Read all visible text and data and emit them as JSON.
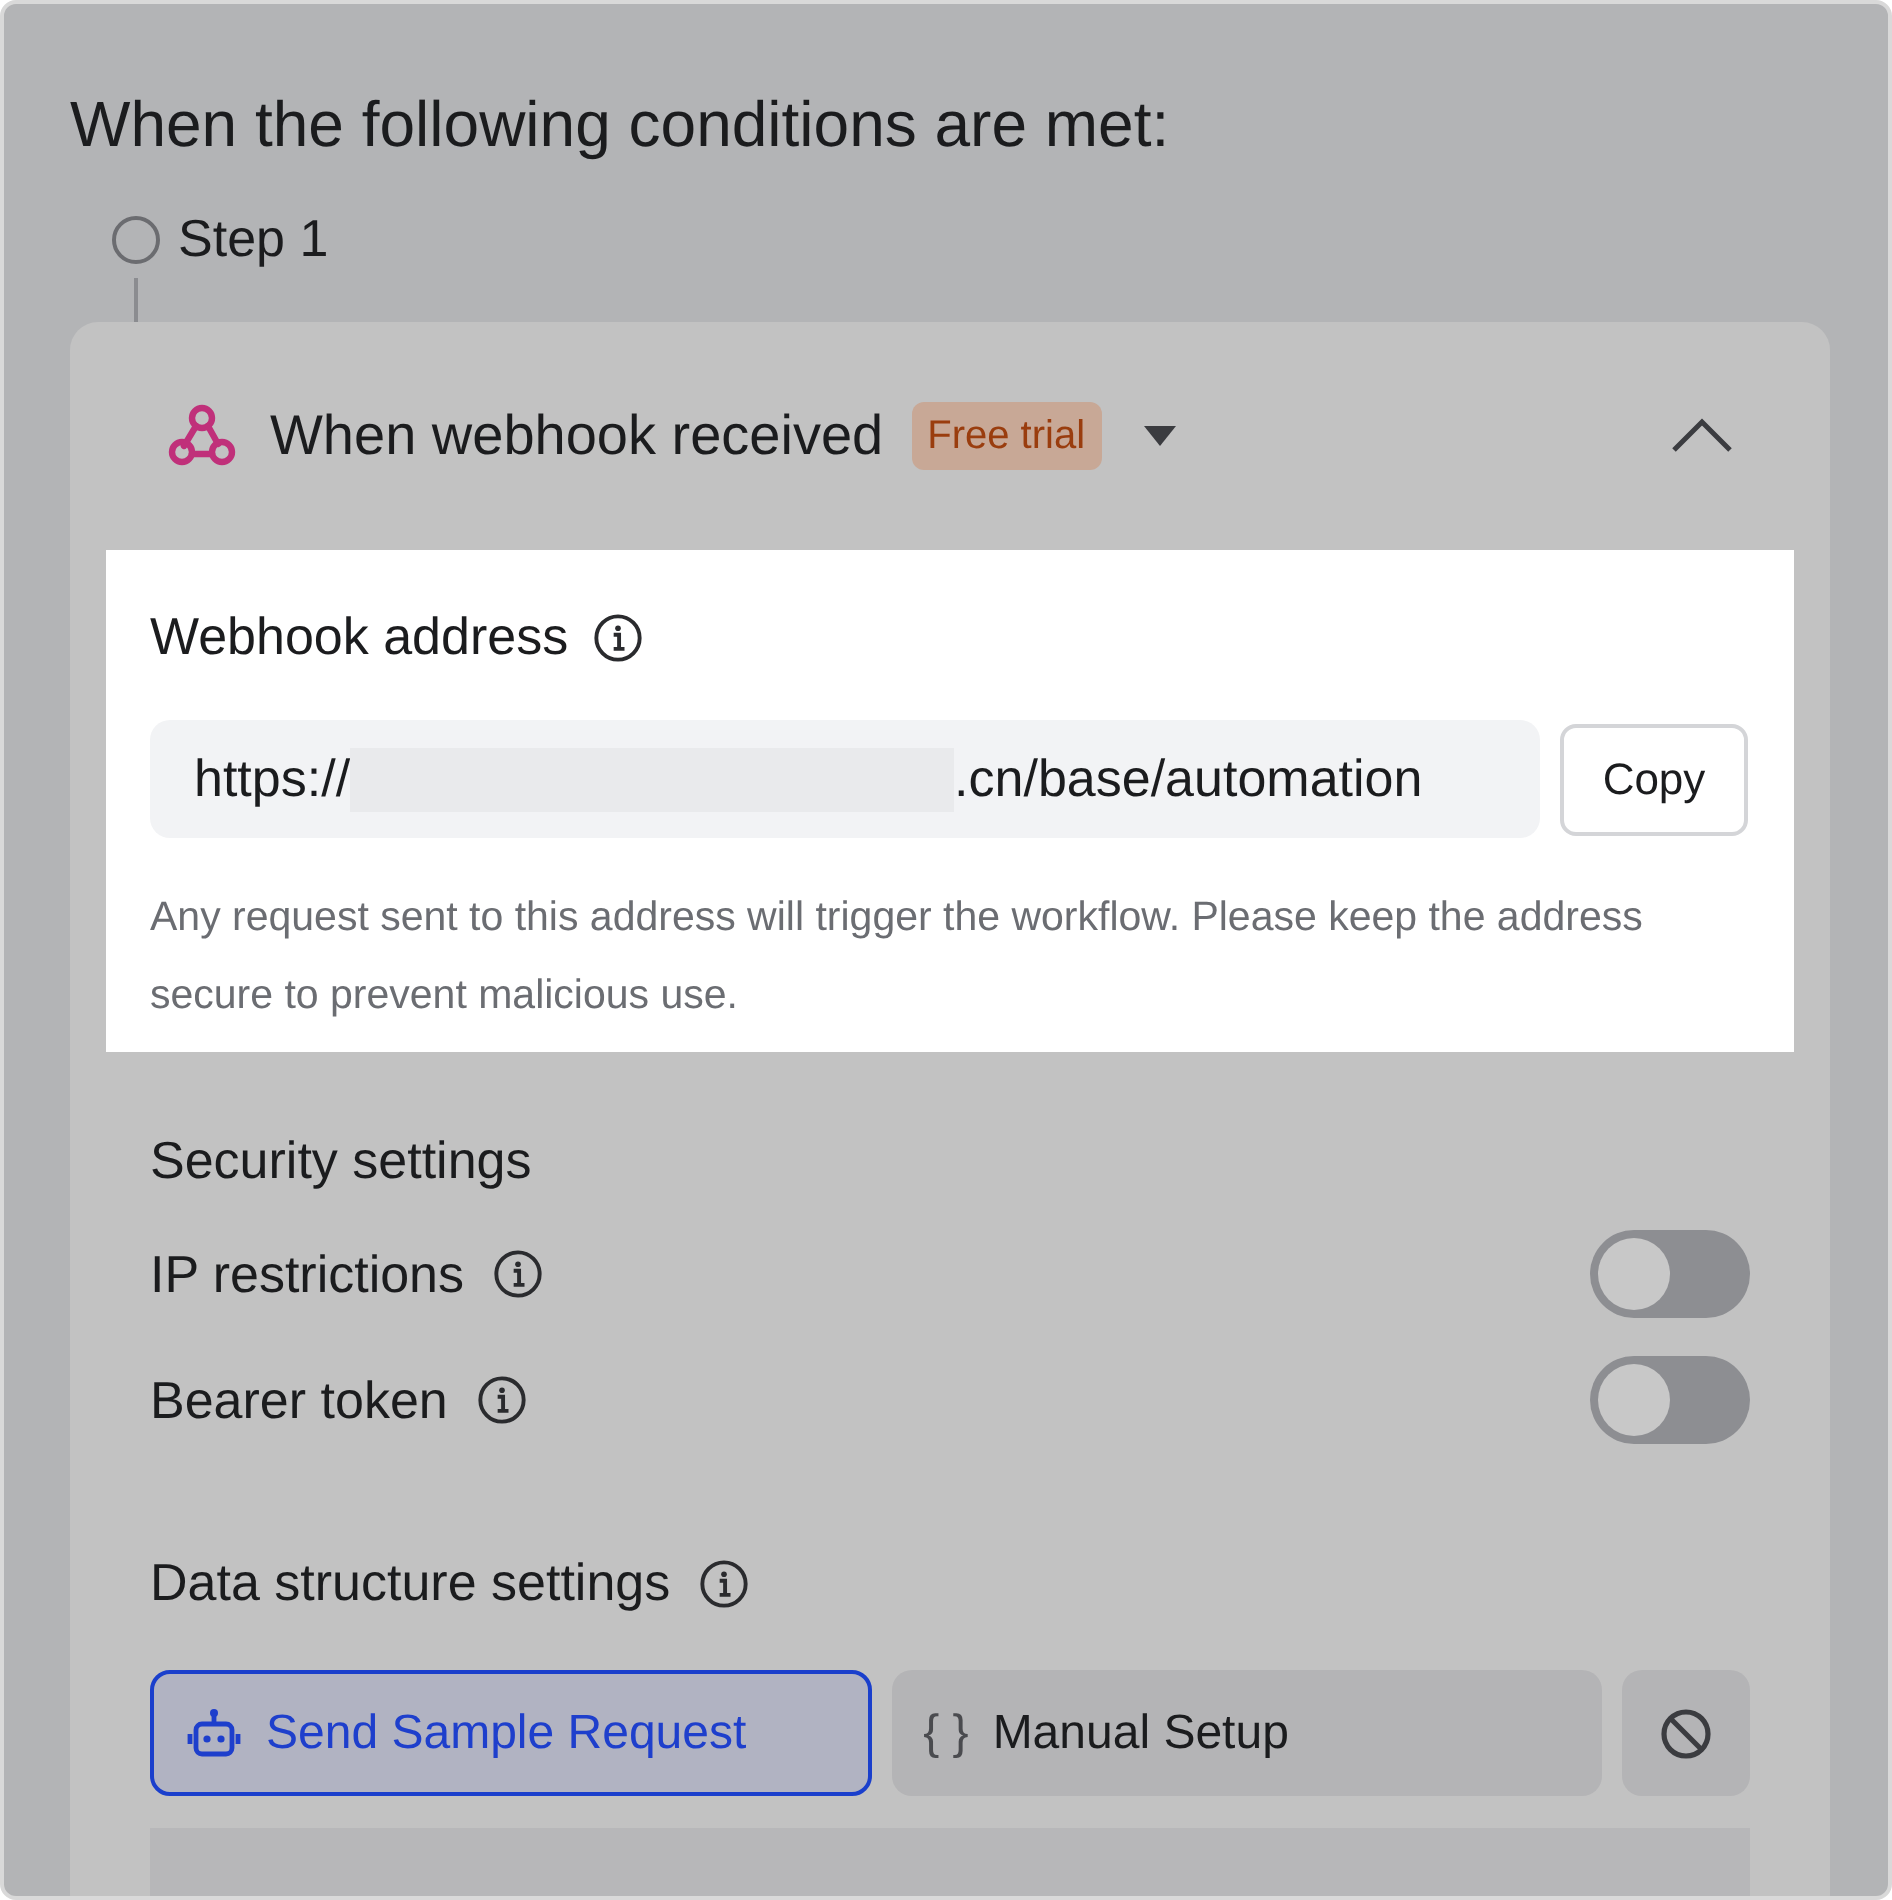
{
  "heading": "When the following conditions are met:",
  "step": {
    "label": "Step 1"
  },
  "trigger": {
    "title": "When webhook received",
    "badge": "Free trial",
    "expanded": true
  },
  "webhook": {
    "label": "Webhook address",
    "url_prefix": "https://",
    "url_suffix": ".cn/base/automation",
    "copy_button": "Copy",
    "description": "Any request sent to this address will trigger the workflow. Please keep the address secure to prevent malicious use."
  },
  "security": {
    "title": "Security settings",
    "options": [
      {
        "label": "IP restrictions",
        "on": false
      },
      {
        "label": "Bearer token",
        "on": false
      }
    ]
  },
  "data_structure": {
    "title": "Data structure settings",
    "modes": [
      {
        "kind": "sample",
        "label": "Send Sample Request",
        "selected": true
      },
      {
        "kind": "manual",
        "icon_text": "{ }",
        "label": "Manual Setup",
        "selected": false
      },
      {
        "kind": "none",
        "selected": false
      }
    ]
  }
}
